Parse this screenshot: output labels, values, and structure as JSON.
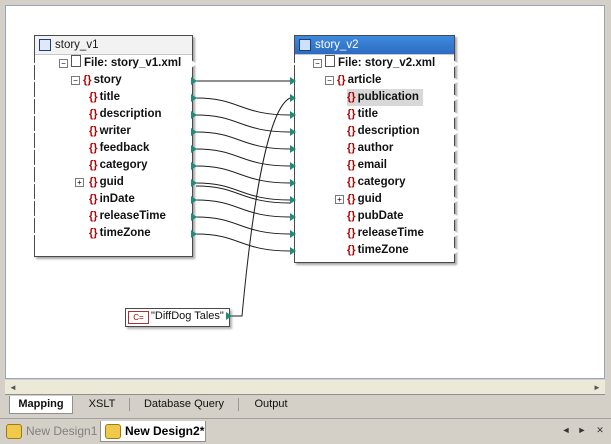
{
  "left_component": {
    "title": "story_v1",
    "file_label": "File: story_v1.xml",
    "root": "story",
    "items": [
      "title",
      "description",
      "writer",
      "feedback",
      "category",
      "guid",
      "inDate",
      "releaseTime",
      "timeZone"
    ]
  },
  "right_component": {
    "title": "story_v2",
    "file_label": "File: story_v2.xml",
    "root": "article",
    "items": [
      "publication",
      "title",
      "description",
      "author",
      "email",
      "category",
      "guid",
      "pubDate",
      "releaseTime",
      "timeZone"
    ]
  },
  "constant": {
    "icon": "C=",
    "value": "\"DiffDog Tales\""
  },
  "view_tabs": [
    "Mapping",
    "XSLT",
    "Database Query",
    "Output"
  ],
  "doc_tabs": [
    "New Design1",
    "New Design2*"
  ],
  "colors": {
    "connector": "#1f1f1f",
    "port_active": "#1f8a7e",
    "brace": "#b30000",
    "selected_title": "#2d6cc0"
  }
}
